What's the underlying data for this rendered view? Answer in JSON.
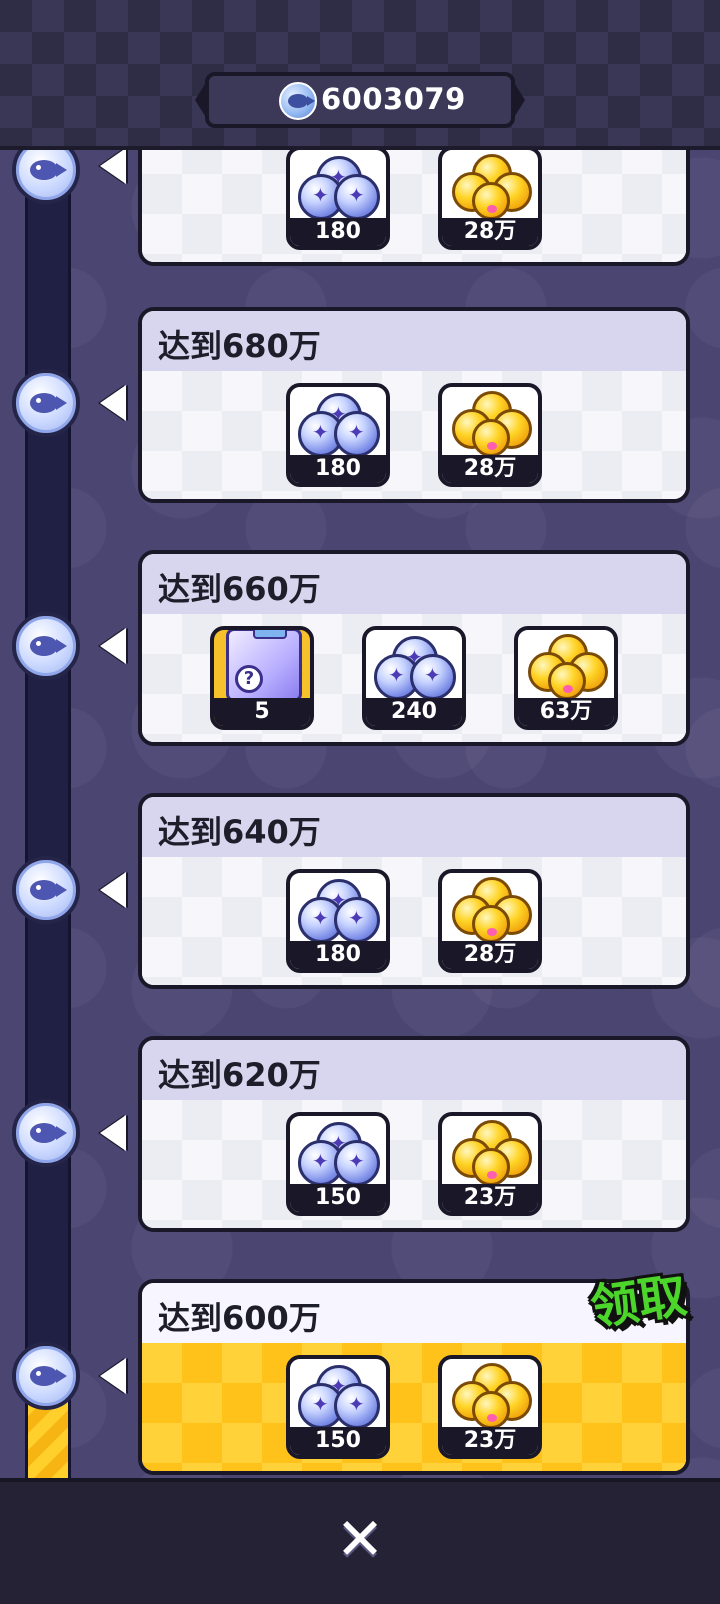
{
  "currency": {
    "icon": "fish-coin-icon",
    "value": "6003079"
  },
  "milestones": [
    {
      "title": "",
      "rewards": [
        {
          "type": "gem",
          "count": "180"
        },
        {
          "type": "candy",
          "count": "28万"
        }
      ]
    },
    {
      "title": "达到680万",
      "rewards": [
        {
          "type": "gem",
          "count": "180"
        },
        {
          "type": "candy",
          "count": "28万"
        }
      ]
    },
    {
      "title": "达到660万",
      "rewards": [
        {
          "type": "box",
          "count": "5"
        },
        {
          "type": "gem",
          "count": "240"
        },
        {
          "type": "candy",
          "count": "63万"
        }
      ]
    },
    {
      "title": "达到640万",
      "rewards": [
        {
          "type": "gem",
          "count": "180"
        },
        {
          "type": "candy",
          "count": "28万"
        }
      ]
    },
    {
      "title": "达到620万",
      "rewards": [
        {
          "type": "gem",
          "count": "150"
        },
        {
          "type": "candy",
          "count": "23万"
        }
      ]
    },
    {
      "title": "达到600万",
      "claimable": true,
      "claim_label": "领取",
      "rewards": [
        {
          "type": "gem",
          "count": "150"
        },
        {
          "type": "candy",
          "count": "23万"
        }
      ]
    }
  ],
  "colors": {
    "accent_gold": "#ffd23a",
    "claim_green": "#4cd62b",
    "track": "#1f2043"
  },
  "close_icon": "close-icon"
}
